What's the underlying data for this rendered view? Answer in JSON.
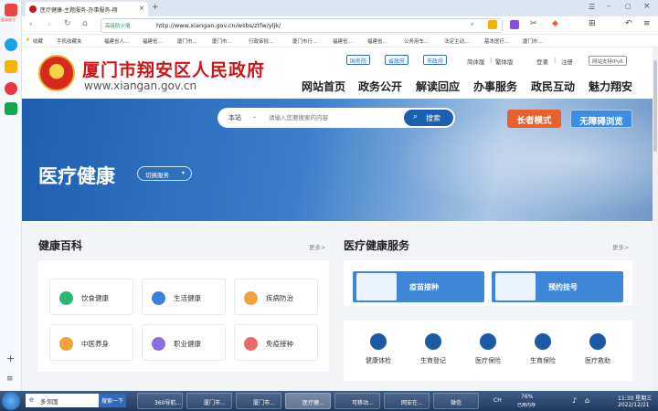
{
  "browser": {
    "tab_title": "医疗健康-主题服务-办事服务-翔",
    "url_secure_label": "高级防火墙",
    "url": "http://www.xiangan.gov.cn/wsbs/ztfw/yljk/",
    "bookmarks": [
      "收藏",
      "手机收藏夹",
      "福建省人...",
      "福建省...",
      "厦门市...",
      "厦门市...",
      "行政审批...",
      "厦门市行...",
      "福建省...",
      "福建省...",
      "公务用车...",
      "法定主动...",
      "基本医疗...",
      "厦门市..."
    ]
  },
  "sidebar": {
    "label_top": "登录账号"
  },
  "header": {
    "site_title": "厦门市翔安区人民政府",
    "site_domain": "www.xiangan.gov.cn",
    "top_links": [
      "国务院",
      "省政府",
      "市政府"
    ],
    "lang_simplified": "简体版",
    "lang_traditional": "繁体版",
    "login": "登录",
    "register": "注册",
    "ipv6": "网站支持IPv6",
    "nav": [
      "网站首页",
      "政务公开",
      "解读回应",
      "办事服务",
      "政民互动",
      "魅力翔安"
    ]
  },
  "banner": {
    "search_scope": "本站",
    "search_placeholder": "请输入您要搜索的内容",
    "search_button": "搜索",
    "elder_mode": "长者模式",
    "accessible_browse": "无障碍浏览",
    "title": "医疗健康",
    "switch_service": "切换服务"
  },
  "health_wiki": {
    "title": "健康百科",
    "more": "更多>",
    "items": [
      {
        "label": "饮食健康",
        "icon": "diet-icon",
        "color": "#2bb673"
      },
      {
        "label": "生活健康",
        "icon": "life-icon",
        "color": "#3b82e0"
      },
      {
        "label": "疾病防治",
        "icon": "disease-prevention-icon",
        "color": "#f0a33c"
      },
      {
        "label": "中医养身",
        "icon": "tcm-icon",
        "color": "#f0a33c"
      },
      {
        "label": "职业健康",
        "icon": "occupational-health-icon",
        "color": "#8a6ee0"
      },
      {
        "label": "免疫接种",
        "icon": "vaccination-icon",
        "color": "#e66a6a"
      }
    ]
  },
  "health_service": {
    "title": "医疗健康服务",
    "more": "更多>",
    "cards": [
      {
        "label": "疫苗接种",
        "icon": "hospital-illustration"
      },
      {
        "label": "预约挂号",
        "icon": "doctor-illustration"
      }
    ],
    "items": [
      {
        "label": "健康体检",
        "icon": "checkup-icon"
      },
      {
        "label": "生育登记",
        "icon": "birth-registration-icon"
      },
      {
        "label": "医疗保险",
        "icon": "medical-insurance-icon"
      },
      {
        "label": "生育保险",
        "icon": "maternity-insurance-icon"
      },
      {
        "label": "医疗救助",
        "icon": "medical-aid-icon"
      }
    ]
  },
  "taskbar": {
    "search_value": "多邻国",
    "search_button": "搜索一下",
    "tasks": [
      "360导航...",
      "厦门市...",
      "厦门市...",
      "医疗健...",
      "可移动...",
      "网安在...",
      "微信"
    ],
    "battery": "76%",
    "battery_label": "已用内存",
    "lang": "CH",
    "time": "11:30 星期三",
    "date": "2022/12/21"
  }
}
